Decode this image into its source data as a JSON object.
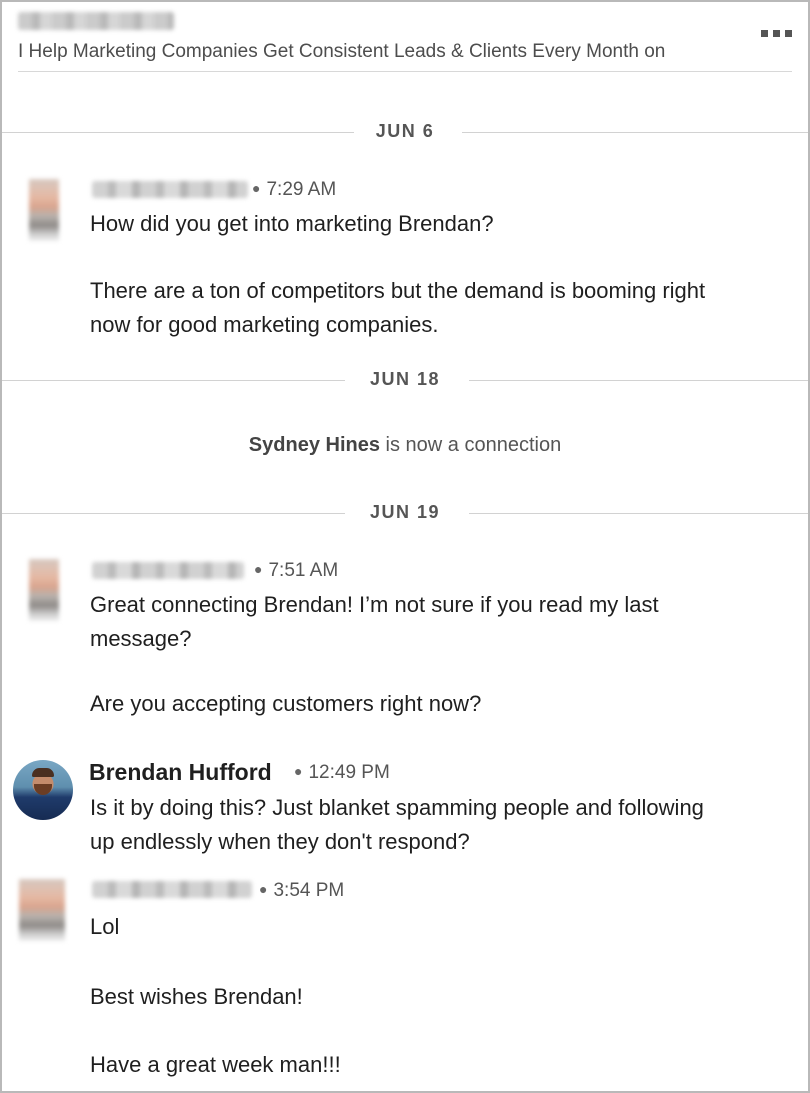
{
  "header": {
    "headline": "I Help Marketing Companies Get Consistent Leads & Clients Every Month on"
  },
  "dates": {
    "d1": "JUN 6",
    "d2": "JUN 18",
    "d3": "JUN 19"
  },
  "connection_note": {
    "name": "Sydney Hines",
    "text": " is now a connection"
  },
  "messages": [
    {
      "time": "7:29 AM",
      "lines": [
        "How did you get into marketing Brendan?",
        "There are a ton of competitors but the demand is booming right",
        "now for good marketing companies."
      ]
    },
    {
      "time": "7:51 AM",
      "lines": [
        "Great connecting Brendan! I’m not sure if you read my last",
        "message?",
        "Are you accepting customers right now?"
      ]
    },
    {
      "sender": "Brendan Hufford",
      "time": "12:49 PM",
      "lines": [
        "Is it by doing this? Just blanket spamming people and following",
        "up endlessly when they don't respond?"
      ]
    },
    {
      "time": "3:54 PM",
      "lines": [
        "Lol",
        "Best wishes Brendan!",
        "Have a great week man!!!"
      ]
    }
  ]
}
